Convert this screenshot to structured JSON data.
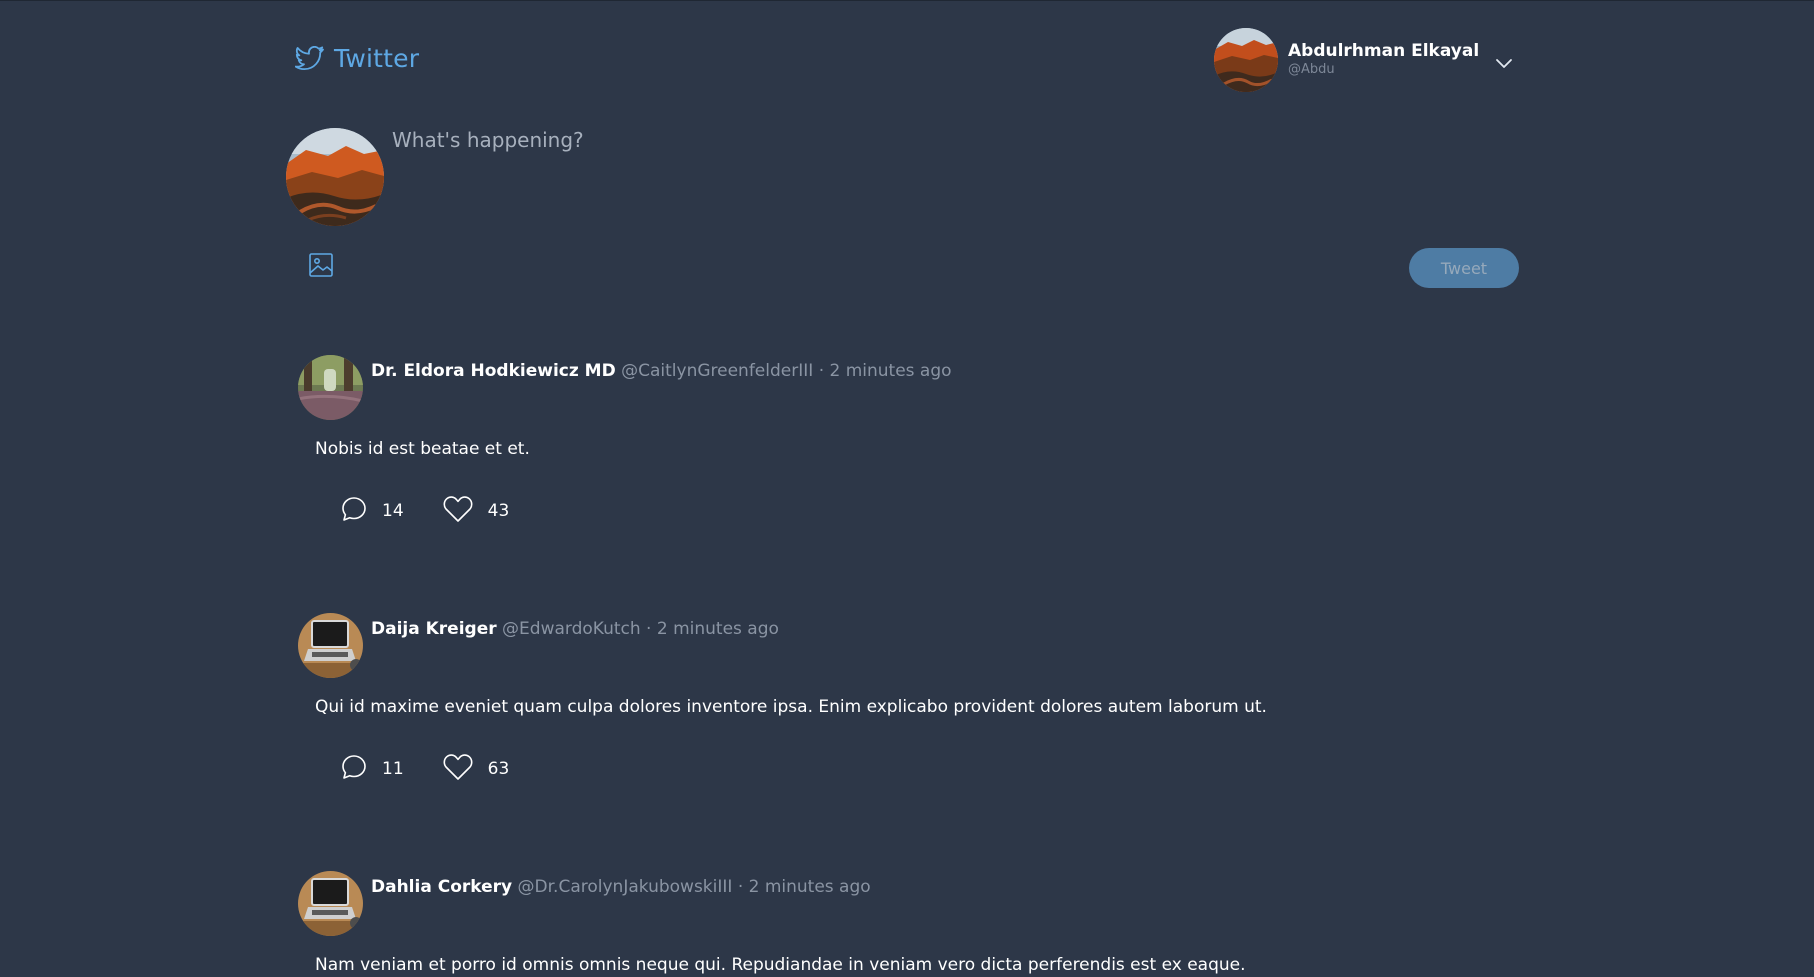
{
  "header": {
    "brand": "Twitter",
    "user": {
      "name": "Abdulrhman Elkayal",
      "handle": "@Abdu"
    }
  },
  "composer": {
    "placeholder": "What's happening?",
    "tweet_label": "Tweet"
  },
  "tweets": [
    {
      "name": "Dr. Eldora Hodkiewicz MD",
      "handle": "@CaitlynGreenfelderIII",
      "time": "2 minutes ago",
      "body": "Nobis id est beatae et et.",
      "replies": "14",
      "likes": "43"
    },
    {
      "name": "Daija Kreiger",
      "handle": "@EdwardoKutch",
      "time": "2 minutes ago",
      "body": "Qui id maxime eveniet quam culpa dolores inventore ipsa. Enim explicabo provident dolores autem laborum ut.",
      "replies": "11",
      "likes": "63"
    },
    {
      "name": "Dahlia Corkery",
      "handle": "@Dr.CarolynJakubowskiIII",
      "time": "2 minutes ago",
      "body": "Nam veniam et porro id omnis omnis neque qui. Repudiandae in veniam vero dicta perferendis est ex eaque."
    }
  ],
  "separator": "·",
  "colors": {
    "background": "#2d3748",
    "accent": "#5ea8e4",
    "tweet_button": "#4e7ca4",
    "muted_text": "#8a94a3"
  },
  "icons": {
    "brand": "twitter-bird-icon",
    "dropdown": "chevron-down-icon",
    "image": "image-icon",
    "reply": "comment-icon",
    "like": "heart-icon"
  }
}
